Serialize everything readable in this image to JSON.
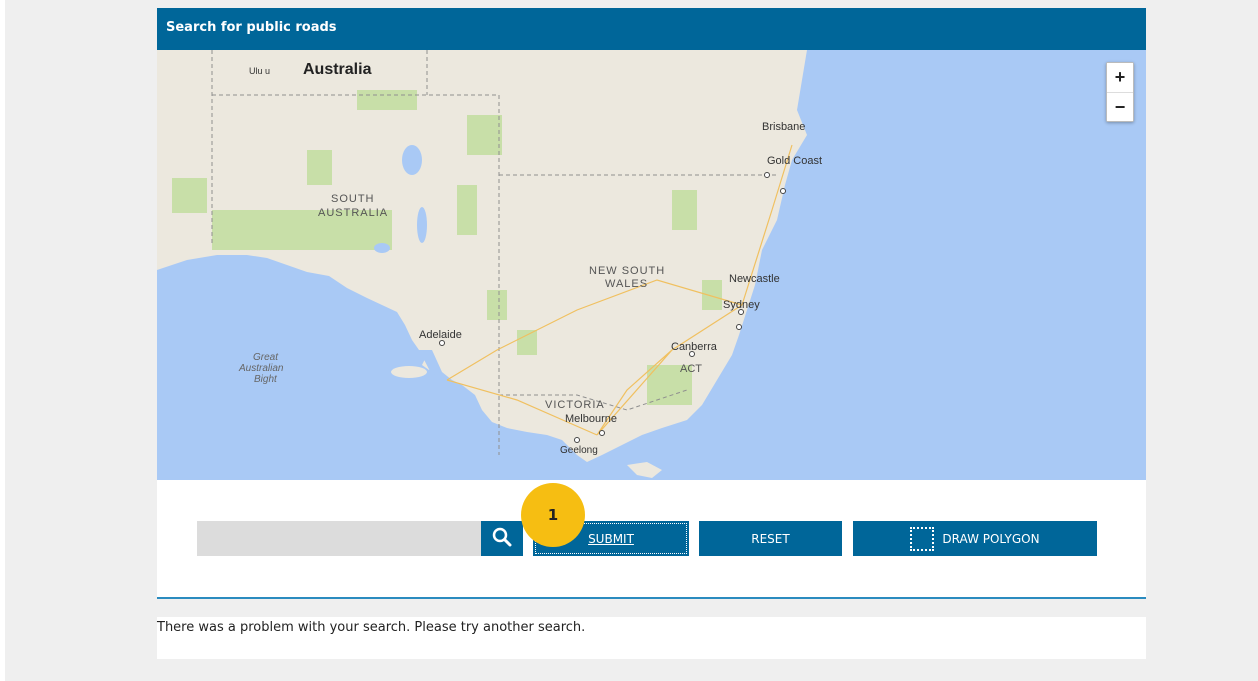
{
  "panel": {
    "title": "Search for public roads"
  },
  "map": {
    "zoom_in": "+",
    "zoom_out": "−",
    "labels": {
      "uluru": "Ulu u",
      "australia": "Australia",
      "south_australia_1": "SOUTH",
      "south_australia_2": "AUSTRALIA",
      "brisbane": "Brisbane",
      "gold_coast": "Gold Coast",
      "nsw_1": "NEW SOUTH",
      "nsw_2": "WALES",
      "newcastle": "Newcastle",
      "sydney": "Sydney",
      "adelaide": "Adelaide",
      "canberra": "Canberra",
      "act": "ACT",
      "bight_1": "Great",
      "bight_2": "Australian",
      "bight_3": "Bight",
      "victoria": "VICTORIA",
      "melbourne": "Melbourne",
      "geelong": "Geelong"
    }
  },
  "controls": {
    "search_value": "",
    "submit_label": "SUBMIT",
    "reset_label": "RESET",
    "draw_polygon_label": "DRAW POLYGON",
    "marker_label": "1"
  },
  "message": {
    "text": "There was a problem with your search. Please try another search."
  },
  "colors": {
    "brand": "#006699",
    "marker": "#f6be12",
    "ocean": "#a9c9f5",
    "land": "#ece8de",
    "park": "#c8dfa8"
  }
}
